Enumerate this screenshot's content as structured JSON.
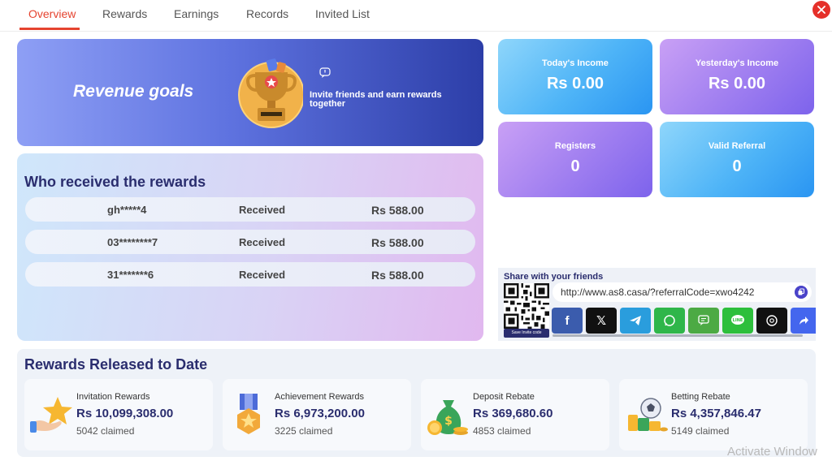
{
  "tabs": [
    {
      "label": "Overview"
    },
    {
      "label": "Rewards"
    },
    {
      "label": "Earnings"
    },
    {
      "label": "Records"
    },
    {
      "label": "Invited List"
    }
  ],
  "banner": {
    "title": "Revenue goals",
    "subtitle": "Invite friends and earn rewards together"
  },
  "received": {
    "title": "Who received the rewards",
    "rows": [
      {
        "name": "gh*****4",
        "status": "Received",
        "amount": "Rs  588.00"
      },
      {
        "name": "03********7",
        "status": "Received",
        "amount": "Rs  588.00"
      },
      {
        "name": "31*******6",
        "status": "Received",
        "amount": "Rs  588.00"
      }
    ]
  },
  "stats": {
    "today": {
      "label": "Today's Income",
      "value": "Rs  0.00"
    },
    "yesterday": {
      "label": "Yesterday's Income",
      "value": "Rs  0.00"
    },
    "registers": {
      "label": "Registers",
      "value": "0"
    },
    "valid": {
      "label": "Valid Referral",
      "value": "0"
    }
  },
  "share": {
    "title": "Share with your friends",
    "url": "http://www.as8.casa/?referralCode=xwo4242",
    "qr_button": "Save Invite code"
  },
  "released": {
    "title": "Rewards Released to Date",
    "cards": [
      {
        "label": "Invitation Rewards",
        "value": "Rs  10,099,308.00",
        "claimed": "5042 claimed"
      },
      {
        "label": "Achievement Rewards",
        "value": "Rs  6,973,200.00",
        "claimed": "3225 claimed"
      },
      {
        "label": "Deposit Rebate",
        "value": "Rs  369,680.60",
        "claimed": "4853 claimed"
      },
      {
        "label": "Betting Rebate",
        "value": "Rs  4,357,846.47",
        "claimed": "5149 claimed"
      }
    ]
  },
  "watermark": "Activate Window",
  "colors": {
    "accent": "#e5432f",
    "title": "#2a2d6e"
  }
}
